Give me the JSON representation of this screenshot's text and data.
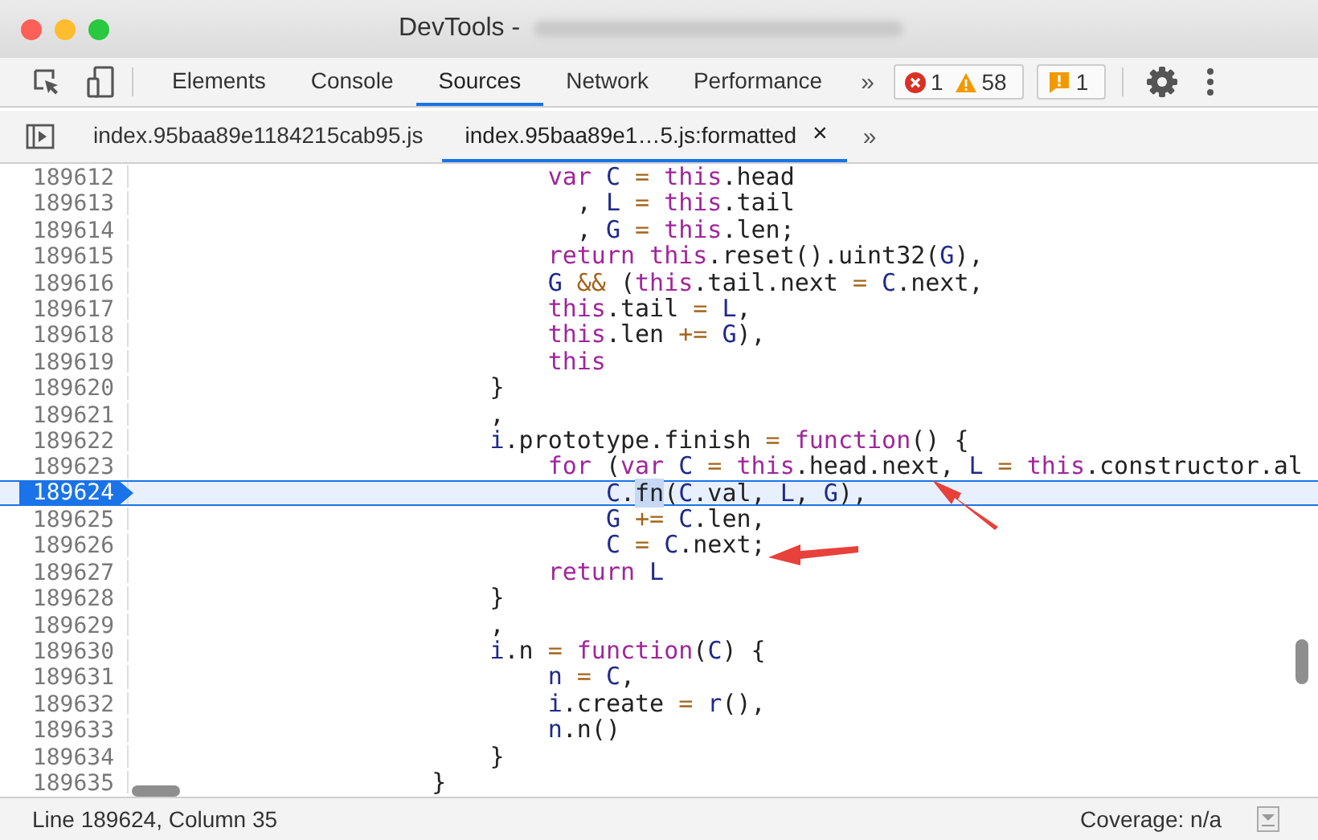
{
  "window": {
    "title": "DevTools -"
  },
  "toolbar": {
    "tabs": [
      {
        "label": "Elements",
        "selected": false
      },
      {
        "label": "Console",
        "selected": false
      },
      {
        "label": "Sources",
        "selected": true
      },
      {
        "label": "Network",
        "selected": false
      },
      {
        "label": "Performance",
        "selected": false
      }
    ],
    "overflow": "»",
    "errors": "1",
    "warnings": "58",
    "issues": "1"
  },
  "file_tabs": {
    "tabs": [
      {
        "label": "index.95baa89e1184215cab95.js",
        "selected": false
      },
      {
        "label": "index.95baa89e1…5.js:formatted",
        "selected": true,
        "close": "×"
      }
    ],
    "overflow": "»"
  },
  "editor": {
    "lines": [
      {
        "number": "189612",
        "selected": false,
        "tokens": [
          {
            "kind": "k",
            "text": "                            var"
          },
          {
            "kind": "v",
            "text": " C"
          },
          {
            "kind": "o",
            "text": " ="
          },
          {
            "kind": "k",
            "text": " this"
          },
          {
            "kind": "p",
            "text": ".head"
          }
        ]
      },
      {
        "number": "189613",
        "selected": false,
        "tokens": [
          {
            "kind": "p",
            "text": "                              ,"
          },
          {
            "kind": "v",
            "text": " L"
          },
          {
            "kind": "o",
            "text": " ="
          },
          {
            "kind": "k",
            "text": " this"
          },
          {
            "kind": "p",
            "text": ".tail"
          }
        ]
      },
      {
        "number": "189614",
        "selected": false,
        "tokens": [
          {
            "kind": "p",
            "text": "                              ,"
          },
          {
            "kind": "v",
            "text": " G"
          },
          {
            "kind": "o",
            "text": " ="
          },
          {
            "kind": "k",
            "text": " this"
          },
          {
            "kind": "p",
            "text": ".len;"
          }
        ]
      },
      {
        "number": "189615",
        "selected": false,
        "tokens": [
          {
            "kind": "k",
            "text": "                            return"
          },
          {
            "kind": "k",
            "text": " this"
          },
          {
            "kind": "p",
            "text": ".reset().uint32("
          },
          {
            "kind": "v",
            "text": "G"
          },
          {
            "kind": "p",
            "text": "),"
          }
        ]
      },
      {
        "number": "189616",
        "selected": false,
        "tokens": [
          {
            "kind": "v",
            "text": "                            G"
          },
          {
            "kind": "o",
            "text": " &&"
          },
          {
            "kind": "p",
            "text": " ("
          },
          {
            "kind": "k",
            "text": "this"
          },
          {
            "kind": "p",
            "text": ".tail.next"
          },
          {
            "kind": "o",
            "text": " ="
          },
          {
            "kind": "v",
            "text": " C"
          },
          {
            "kind": "p",
            "text": ".next,"
          }
        ]
      },
      {
        "number": "189617",
        "selected": false,
        "tokens": [
          {
            "kind": "k",
            "text": "                            this"
          },
          {
            "kind": "p",
            "text": ".tail"
          },
          {
            "kind": "o",
            "text": " ="
          },
          {
            "kind": "v",
            "text": " L"
          },
          {
            "kind": "p",
            "text": ","
          }
        ]
      },
      {
        "number": "189618",
        "selected": false,
        "tokens": [
          {
            "kind": "k",
            "text": "                            this"
          },
          {
            "kind": "p",
            "text": ".len"
          },
          {
            "kind": "o",
            "text": " +="
          },
          {
            "kind": "v",
            "text": " G"
          },
          {
            "kind": "p",
            "text": "),"
          }
        ]
      },
      {
        "number": "189619",
        "selected": false,
        "tokens": [
          {
            "kind": "k",
            "text": "                            this"
          }
        ]
      },
      {
        "number": "189620",
        "selected": false,
        "tokens": [
          {
            "kind": "p",
            "text": "                        }"
          }
        ]
      },
      {
        "number": "189621",
        "selected": false,
        "tokens": [
          {
            "kind": "p",
            "text": "                        ,"
          }
        ]
      },
      {
        "number": "189622",
        "selected": false,
        "tokens": [
          {
            "kind": "v",
            "text": "                        i"
          },
          {
            "kind": "p",
            "text": ".prototype.finish"
          },
          {
            "kind": "o",
            "text": " ="
          },
          {
            "kind": "k",
            "text": " function"
          },
          {
            "kind": "p",
            "text": "() {"
          }
        ]
      },
      {
        "number": "189623",
        "selected": false,
        "tokens": [
          {
            "kind": "k",
            "text": "                            for"
          },
          {
            "kind": "p",
            "text": " ("
          },
          {
            "kind": "k",
            "text": "var"
          },
          {
            "kind": "v",
            "text": " C"
          },
          {
            "kind": "o",
            "text": " ="
          },
          {
            "kind": "k",
            "text": " this"
          },
          {
            "kind": "p",
            "text": ".head.next,"
          },
          {
            "kind": "v",
            "text": " L"
          },
          {
            "kind": "o",
            "text": " ="
          },
          {
            "kind": "k",
            "text": " this"
          },
          {
            "kind": "p",
            "text": ".constructor.al"
          }
        ]
      },
      {
        "number": "189624",
        "selected": true,
        "tokens": [
          {
            "kind": "v",
            "text": "                                C"
          },
          {
            "kind": "p",
            "text": "."
          },
          {
            "kind": "s",
            "text": "fn"
          },
          {
            "kind": "p",
            "text": "("
          },
          {
            "kind": "v",
            "text": "C"
          },
          {
            "kind": "p",
            "text": ".val,"
          },
          {
            "kind": "v",
            "text": " L"
          },
          {
            "kind": "p",
            "text": ","
          },
          {
            "kind": "v",
            "text": " G"
          },
          {
            "kind": "p",
            "text": "),"
          }
        ]
      },
      {
        "number": "189625",
        "selected": false,
        "tokens": [
          {
            "kind": "v",
            "text": "                                G"
          },
          {
            "kind": "o",
            "text": " +="
          },
          {
            "kind": "v",
            "text": " C"
          },
          {
            "kind": "p",
            "text": ".len,"
          }
        ]
      },
      {
        "number": "189626",
        "selected": false,
        "tokens": [
          {
            "kind": "v",
            "text": "                                C"
          },
          {
            "kind": "o",
            "text": " ="
          },
          {
            "kind": "v",
            "text": " C"
          },
          {
            "kind": "p",
            "text": ".next;"
          }
        ]
      },
      {
        "number": "189627",
        "selected": false,
        "tokens": [
          {
            "kind": "k",
            "text": "                            return"
          },
          {
            "kind": "v",
            "text": " L"
          }
        ]
      },
      {
        "number": "189628",
        "selected": false,
        "tokens": [
          {
            "kind": "p",
            "text": "                        }"
          }
        ]
      },
      {
        "number": "189629",
        "selected": false,
        "tokens": [
          {
            "kind": "p",
            "text": "                        ,"
          }
        ]
      },
      {
        "number": "189630",
        "selected": false,
        "tokens": [
          {
            "kind": "v",
            "text": "                        i"
          },
          {
            "kind": "p",
            "text": ".n"
          },
          {
            "kind": "o",
            "text": " ="
          },
          {
            "kind": "k",
            "text": " function"
          },
          {
            "kind": "p",
            "text": "("
          },
          {
            "kind": "v",
            "text": "C"
          },
          {
            "kind": "p",
            "text": ") {"
          }
        ]
      },
      {
        "number": "189631",
        "selected": false,
        "tokens": [
          {
            "kind": "v",
            "text": "                            n"
          },
          {
            "kind": "o",
            "text": " ="
          },
          {
            "kind": "v",
            "text": " C"
          },
          {
            "kind": "p",
            "text": ","
          }
        ]
      },
      {
        "number": "189632",
        "selected": false,
        "tokens": [
          {
            "kind": "v",
            "text": "                            i"
          },
          {
            "kind": "p",
            "text": ".create"
          },
          {
            "kind": "o",
            "text": " ="
          },
          {
            "kind": "v",
            "text": " r"
          },
          {
            "kind": "p",
            "text": "(),"
          }
        ]
      },
      {
        "number": "189633",
        "selected": false,
        "tokens": [
          {
            "kind": "v",
            "text": "                            n"
          },
          {
            "kind": "p",
            "text": ".n()"
          }
        ]
      },
      {
        "number": "189634",
        "selected": false,
        "tokens": [
          {
            "kind": "p",
            "text": "                        }"
          }
        ]
      },
      {
        "number": "189635",
        "selected": false,
        "tokens": [
          {
            "kind": "p",
            "text": "                    }"
          }
        ]
      }
    ]
  },
  "status_bar": {
    "position": "Line 189624, Column 35",
    "coverage": "Coverage: n/a"
  }
}
